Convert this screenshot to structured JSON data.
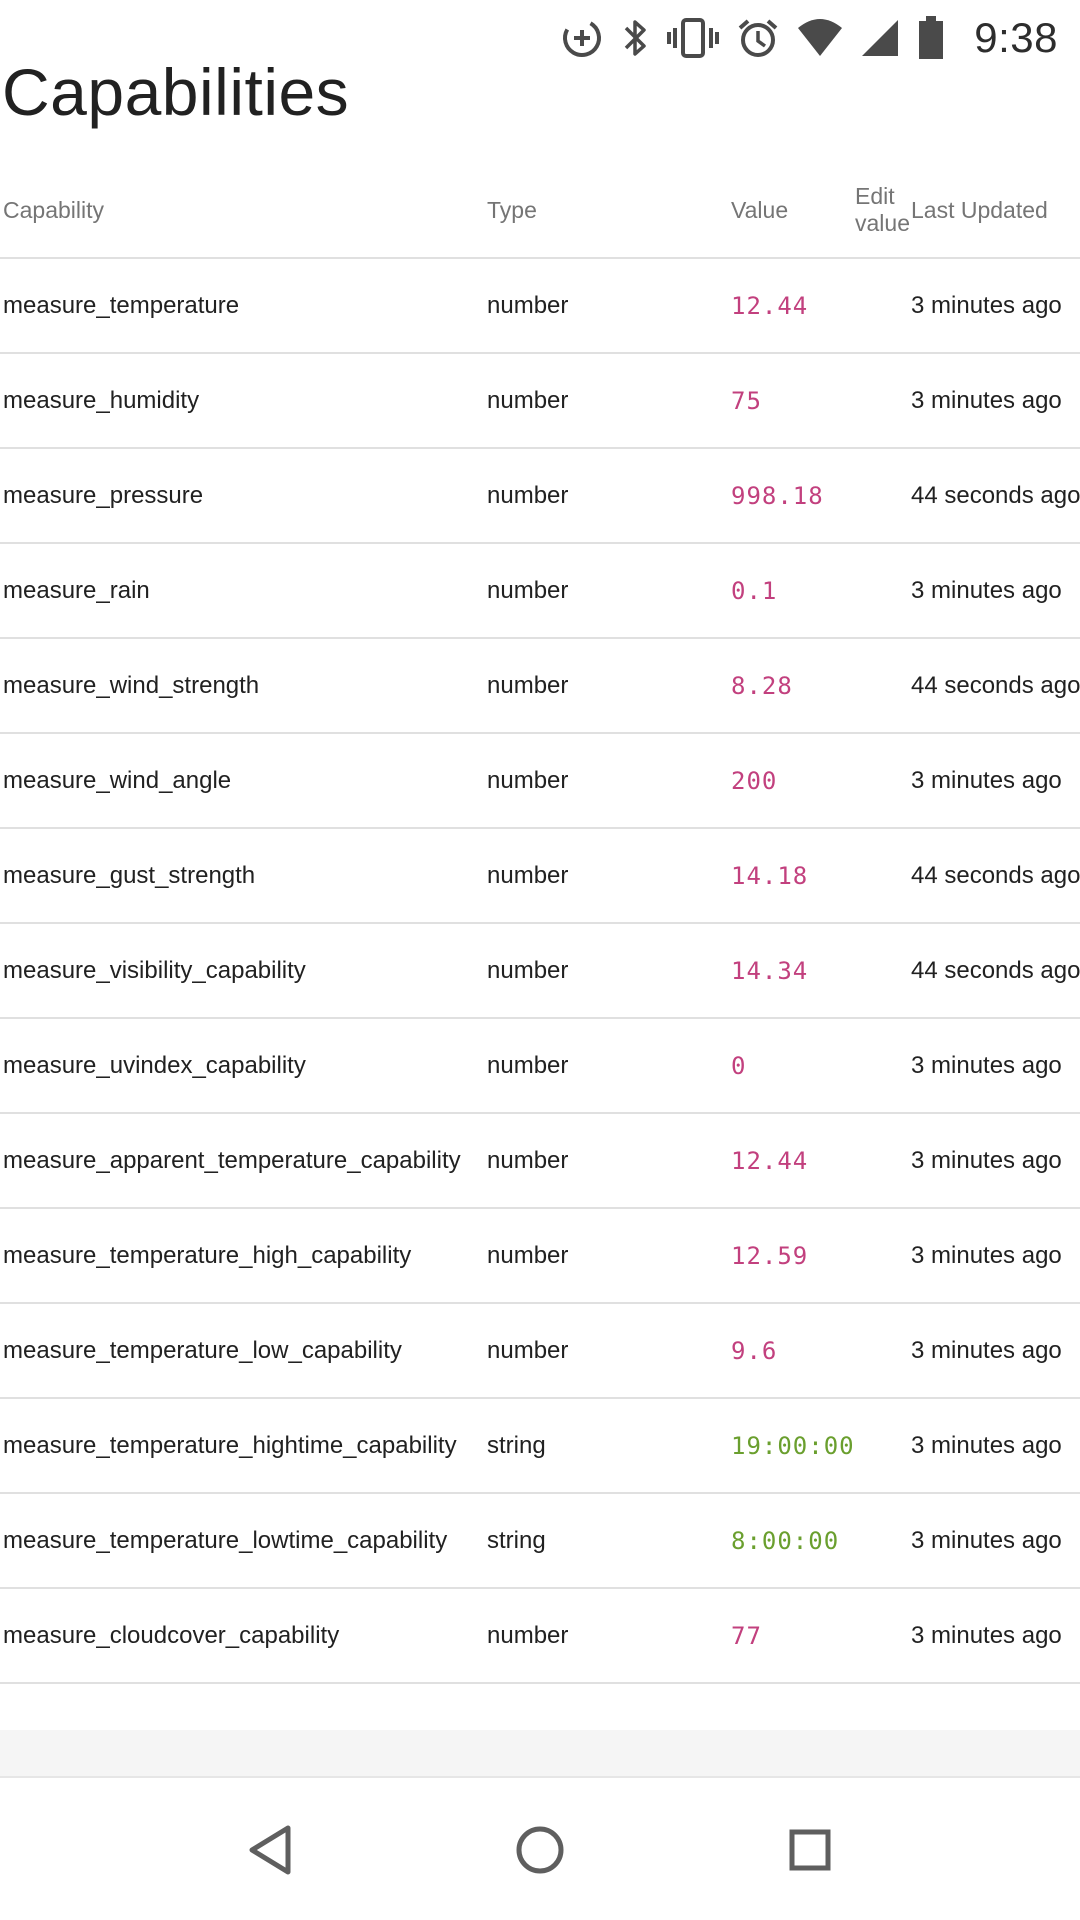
{
  "status_bar": {
    "time": "9:38",
    "icons": [
      "data-saver-icon",
      "bluetooth-icon",
      "vibrate-icon",
      "alarm-icon",
      "wifi-icon",
      "cell-signal-icon",
      "battery-icon"
    ]
  },
  "page": {
    "title": "Capabilities"
  },
  "table": {
    "headers": {
      "capability": "Capability",
      "type": "Type",
      "value": "Value",
      "edit_line1": "Edit",
      "edit_line2": "value",
      "last_updated": "Last Updated"
    },
    "rows": [
      {
        "capability": "measure_temperature",
        "type": "number",
        "value": "12.44",
        "last_updated": "3 minutes ago"
      },
      {
        "capability": "measure_humidity",
        "type": "number",
        "value": "75",
        "last_updated": "3 minutes ago"
      },
      {
        "capability": "measure_pressure",
        "type": "number",
        "value": "998.18",
        "last_updated": "44 seconds ago"
      },
      {
        "capability": "measure_rain",
        "type": "number",
        "value": "0.1",
        "last_updated": "3 minutes ago"
      },
      {
        "capability": "measure_wind_strength",
        "type": "number",
        "value": "8.28",
        "last_updated": "44 seconds ago"
      },
      {
        "capability": "measure_wind_angle",
        "type": "number",
        "value": "200",
        "last_updated": "3 minutes ago"
      },
      {
        "capability": "measure_gust_strength",
        "type": "number",
        "value": "14.18",
        "last_updated": "44 seconds ago"
      },
      {
        "capability": "measure_visibility_capability",
        "type": "number",
        "value": "14.34",
        "last_updated": "44 seconds ago"
      },
      {
        "capability": "measure_uvindex_capability",
        "type": "number",
        "value": "0",
        "last_updated": "3 minutes ago"
      },
      {
        "capability": "measure_apparent_temperature_capability",
        "type": "number",
        "value": "12.44",
        "last_updated": "3 minutes ago"
      },
      {
        "capability": "measure_temperature_high_capability",
        "type": "number",
        "value": "12.59",
        "last_updated": "3 minutes ago"
      },
      {
        "capability": "measure_temperature_low_capability",
        "type": "number",
        "value": "9.6",
        "last_updated": "3 minutes ago"
      },
      {
        "capability": "measure_temperature_hightime_capability",
        "type": "string",
        "value": "19:00:00",
        "last_updated": "3 minutes ago"
      },
      {
        "capability": "measure_temperature_lowtime_capability",
        "type": "string",
        "value": "8:00:00",
        "last_updated": "3 minutes ago"
      },
      {
        "capability": "measure_cloudcover_capability",
        "type": "number",
        "value": "77",
        "last_updated": "3 minutes ago"
      }
    ]
  },
  "colors": {
    "number_value": "#c2407e",
    "string_value": "#6a9f2e"
  },
  "nav_bar": {
    "icons": [
      "back-icon",
      "home-icon",
      "recent-apps-icon"
    ]
  }
}
